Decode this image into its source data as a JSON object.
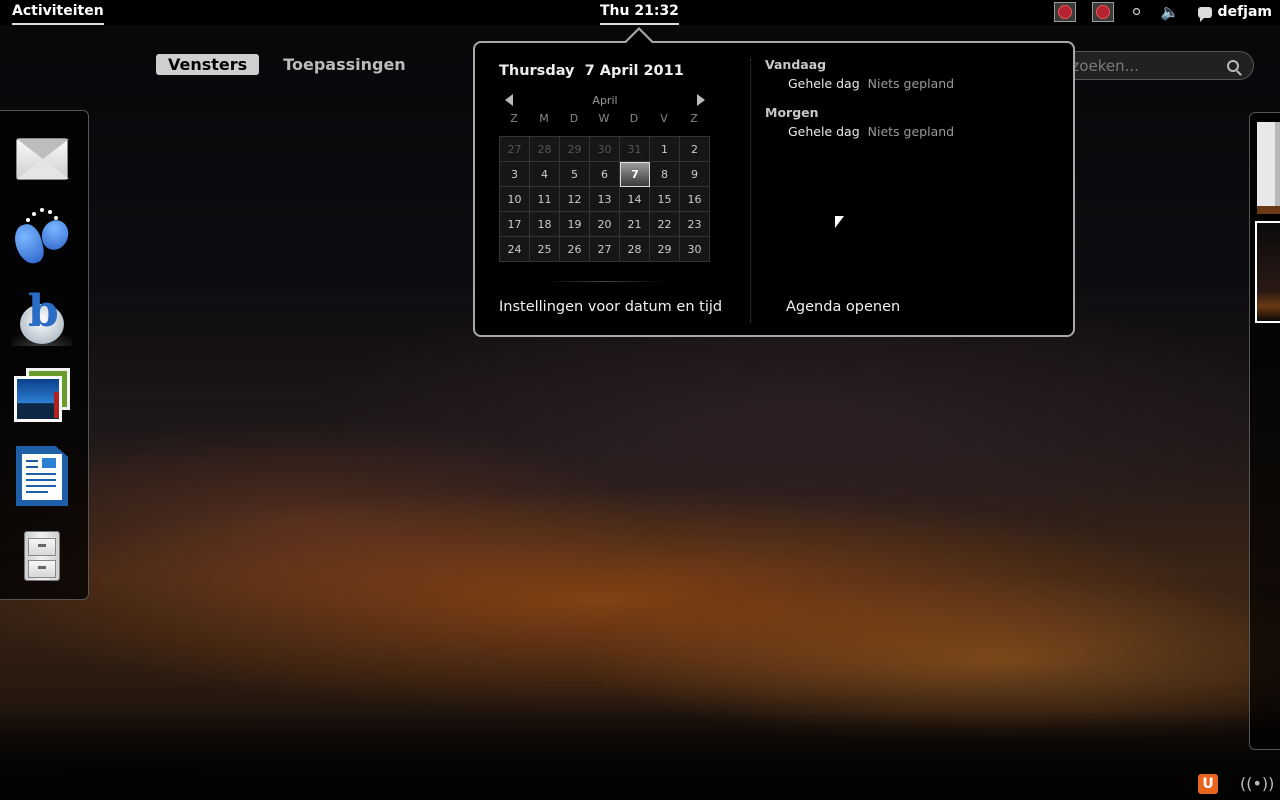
{
  "top_panel": {
    "activities_label": "Activiteiten",
    "clock_label": "Thu 21:32",
    "user_name": "defjam",
    "accessibility_icon": "accessibility-icon",
    "volume_icon": "volume-icon"
  },
  "view_selector": {
    "tabs": [
      {
        "label": "Vensters",
        "active": true
      },
      {
        "label": "Toepassingen",
        "active": false
      }
    ]
  },
  "search": {
    "placeholder": "Typ om te zoeken..."
  },
  "dash": {
    "items": [
      {
        "icon": "mail-client-icon"
      },
      {
        "icon": "empathy-chat-icon"
      },
      {
        "icon": "banshee-music-icon"
      },
      {
        "icon": "photo-viewer-icon"
      },
      {
        "icon": "libreoffice-writer-icon"
      },
      {
        "icon": "file-cabinet-icon"
      }
    ]
  },
  "calendar": {
    "date_heading": "Thursday  7 April 2011",
    "month_label": "April",
    "weekdays": [
      "Z",
      "M",
      "D",
      "W",
      "D",
      "V",
      "Z"
    ],
    "days": [
      {
        "d": "27",
        "other": true
      },
      {
        "d": "28",
        "other": true
      },
      {
        "d": "29",
        "other": true
      },
      {
        "d": "30",
        "other": true
      },
      {
        "d": "31",
        "other": true
      },
      {
        "d": "1"
      },
      {
        "d": "2"
      },
      {
        "d": "3"
      },
      {
        "d": "4"
      },
      {
        "d": "5"
      },
      {
        "d": "6"
      },
      {
        "d": "7",
        "today": true
      },
      {
        "d": "8"
      },
      {
        "d": "9"
      },
      {
        "d": "10"
      },
      {
        "d": "11"
      },
      {
        "d": "12"
      },
      {
        "d": "13"
      },
      {
        "d": "14"
      },
      {
        "d": "15"
      },
      {
        "d": "16"
      },
      {
        "d": "17"
      },
      {
        "d": "18"
      },
      {
        "d": "19"
      },
      {
        "d": "20"
      },
      {
        "d": "21"
      },
      {
        "d": "22"
      },
      {
        "d": "23"
      },
      {
        "d": "24"
      },
      {
        "d": "25"
      },
      {
        "d": "26"
      },
      {
        "d": "27"
      },
      {
        "d": "28"
      },
      {
        "d": "29"
      },
      {
        "d": "30"
      }
    ],
    "settings_link": "Instellingen voor datum en tijd",
    "agenda_link": "Agenda openen",
    "events": [
      {
        "heading": "Vandaag",
        "time": "Gehele dag",
        "text": "Niets gepland"
      },
      {
        "heading": "Morgen",
        "time": "Gehele dag",
        "text": "Niets gepland"
      }
    ]
  },
  "bottom_tray": {
    "ubuntu_one_label": "U"
  }
}
